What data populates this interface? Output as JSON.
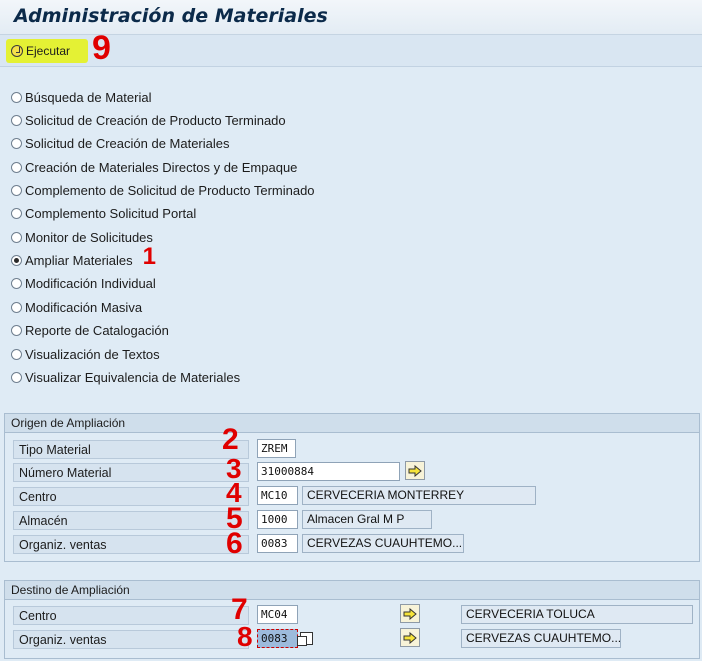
{
  "window": {
    "title": "Administración de Materiales"
  },
  "toolbar": {
    "execute_label": "Ejecutar"
  },
  "options": [
    {
      "label": "Búsqueda de Material",
      "checked": false
    },
    {
      "label": "Solicitud de Creación de Producto Terminado",
      "checked": false
    },
    {
      "label": "Solicitud de Creación de Materiales",
      "checked": false
    },
    {
      "label": "Creación de Materiales Directos y de Empaque",
      "checked": false
    },
    {
      "label": "Complemento de Solicitud de Producto Terminado",
      "checked": false
    },
    {
      "label": "Complemento Solicitud Portal",
      "checked": false
    },
    {
      "label": "Monitor de Solicitudes",
      "checked": false
    },
    {
      "label": "Ampliar Materiales",
      "checked": true
    },
    {
      "label": "Modificación Individual",
      "checked": false
    },
    {
      "label": "Modificación Masiva",
      "checked": false
    },
    {
      "label": "Reporte de Catalogación",
      "checked": false
    },
    {
      "label": "Visualización de Textos",
      "checked": false
    },
    {
      "label": "Visualizar Equivalencia de Materiales",
      "checked": false
    }
  ],
  "origin": {
    "title": "Origen de Ampliación",
    "fields": {
      "tipo_material": {
        "label": "Tipo Material",
        "value": "ZREM"
      },
      "numero_material": {
        "label": "Número Material",
        "value": "31000884"
      },
      "centro": {
        "label": "Centro",
        "value": "MC10",
        "desc": "CERVECERIA MONTERREY"
      },
      "almacen": {
        "label": "Almacén",
        "value": "1000",
        "desc": "Almacen Gral M P"
      },
      "org_ventas": {
        "label": "Organiz. ventas",
        "value": "0083",
        "desc": "CERVEZAS CUAUHTEMO..."
      }
    }
  },
  "destination": {
    "title": "Destino de Ampliación",
    "fields": {
      "centro": {
        "label": "Centro",
        "value": "MC04",
        "desc": "CERVECERIA TOLUCA"
      },
      "org_ventas": {
        "label": "Organiz. ventas",
        "value": "0083",
        "desc": "CERVEZAS CUAUHTEMO..."
      }
    }
  },
  "annotations": [
    "9",
    "1",
    "2",
    "3",
    "4",
    "5",
    "6",
    "7",
    "8"
  ],
  "colors": {
    "highlight": "#e5f213",
    "annotation": "#e00000",
    "background": "#dfebf5"
  }
}
